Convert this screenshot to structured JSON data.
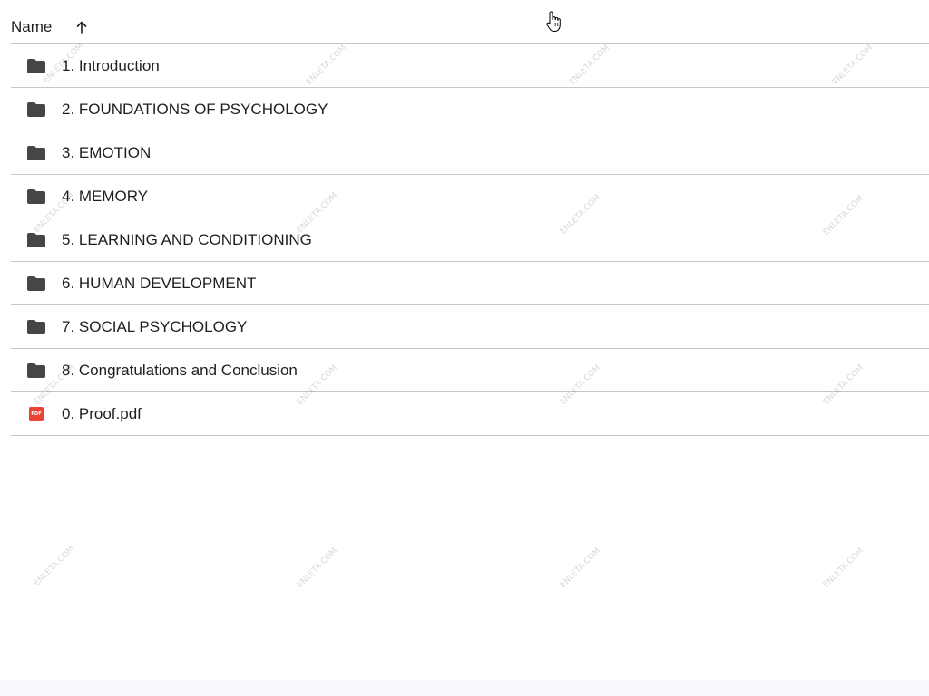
{
  "header": {
    "name_label": "Name",
    "sort_icon": "arrow-up-icon"
  },
  "files": [
    {
      "name": "1. Introduction",
      "icon": "folder-icon"
    },
    {
      "name": "2. FOUNDATIONS OF PSYCHOLOGY",
      "icon": "folder-icon"
    },
    {
      "name": "3. EMOTION",
      "icon": "folder-icon"
    },
    {
      "name": "4. MEMORY",
      "icon": "folder-icon"
    },
    {
      "name": "5. LEARNING AND CONDITIONING",
      "icon": "folder-icon"
    },
    {
      "name": "6. HUMAN DEVELOPMENT",
      "icon": "folder-icon"
    },
    {
      "name": "7. SOCIAL PSYCHOLOGY",
      "icon": "folder-icon"
    },
    {
      "name": "8. Congratulations and Conclusion",
      "icon": "folder-icon"
    },
    {
      "name": "0. Proof.pdf",
      "icon": "pdf-icon",
      "icon_text": "PDF"
    }
  ],
  "watermark": {
    "text": "ENLETA.COM"
  },
  "cursor": {
    "icon": "hand-pointer-icon"
  },
  "colors": {
    "text": "#1f1f1f",
    "folder": "#444746",
    "pdf": "#ea4335",
    "divider": "#c7c7c7",
    "bottom_bar": "#f8f9fc"
  }
}
